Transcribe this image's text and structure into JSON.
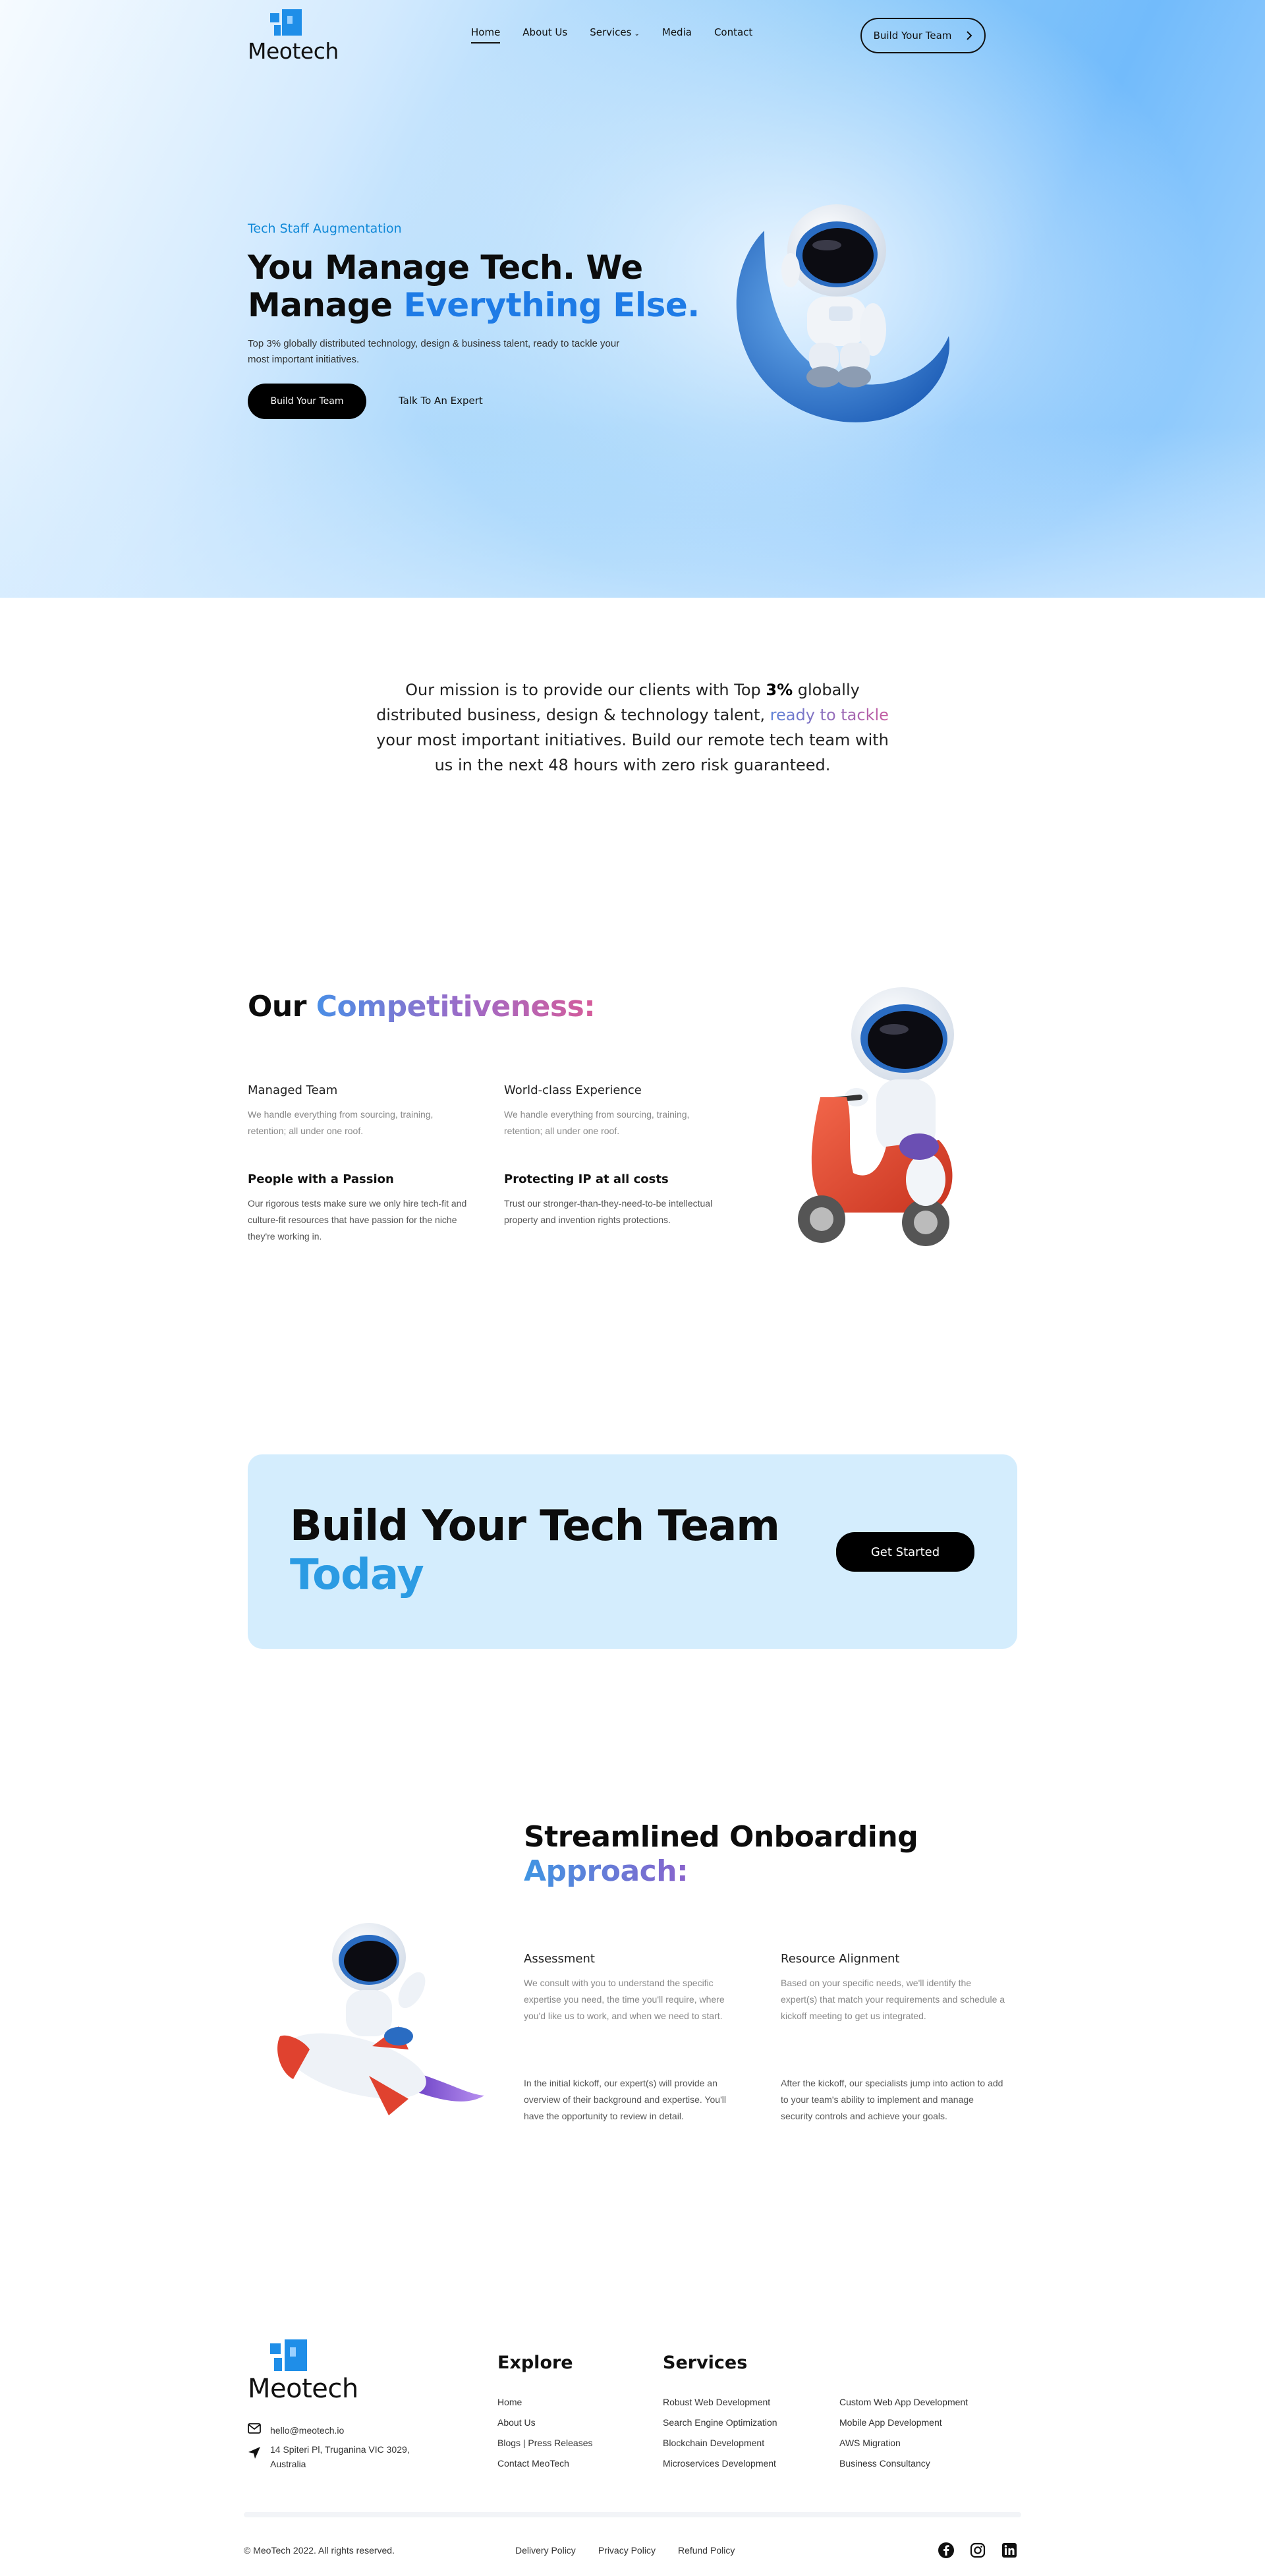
{
  "brand": {
    "name": "Meotech",
    "color": "#1f8ee8"
  },
  "nav": {
    "items": [
      {
        "label": "Home",
        "active": true
      },
      {
        "label": "About Us",
        "active": false
      },
      {
        "label": "Services",
        "active": false,
        "dropdown": true
      },
      {
        "label": "Media",
        "active": false
      },
      {
        "label": "Contact",
        "active": false
      }
    ],
    "cta_label": "Build Your Team",
    "cta_icon": "chevron-right-icon"
  },
  "hero": {
    "eyebrow": "Tech Staff Augmentation",
    "title_line1": "You Manage Tech. We",
    "title_line2_plain": "Manage ",
    "title_line2_accent": "Everything Else.",
    "description": "Top 3% globally distributed technology, design & business talent, ready to tackle your most important initiatives.",
    "primary_button": "Build Your Team",
    "secondary_button": "Talk To An Expert",
    "illustration": "astronaut-on-moon"
  },
  "mission": {
    "part1": "Our mission is to provide our clients with Top ",
    "bold": "3%",
    "part2": " globally distributed business, design & technology talent, ",
    "highlight": "ready to tackle",
    "part3": " your most important initiatives. Build our remote tech team with us in the next 48 hours with zero risk guaranteed."
  },
  "competitiveness": {
    "title_plain": "Our ",
    "title_accent": "Competitiveness:",
    "features": [
      {
        "title": "Managed Team",
        "text": "We handle everything from sourcing, training, retention; all under one roof."
      },
      {
        "title": "World-class Experience",
        "text": "We handle everything from sourcing, training, retention; all under one roof."
      },
      {
        "title": "People with a Passion",
        "text": "Our rigorous tests make sure we only hire tech-fit and culture-fit resources that have passion for the niche they're working in."
      },
      {
        "title": "Protecting IP at all costs",
        "text": "Trust our stronger-than-they-need-to-be intellectual property and invention rights protections."
      }
    ],
    "illustration": "astronaut-on-scooter"
  },
  "cta": {
    "title_line1": "Build Your Tech Team",
    "title_line2": "Today",
    "button": "Get Started"
  },
  "onboarding": {
    "title_line1": "Streamlined Onboarding",
    "title_line2": "Approach:",
    "illustration": "astronaut-on-rocket",
    "steps": [
      {
        "title": "Assessment",
        "text": "We consult with you to understand the specific expertise you need, the time you'll require, where you'd like us to work, and when we need to start."
      },
      {
        "title": "Resource Alignment",
        "text": "Based on your specific needs, we'll identify the expert(s) that match your requirements and schedule a kickoff meeting to get us integrated."
      },
      {
        "title": "",
        "text": "In the initial kickoff, our expert(s) will provide an overview of their background and expertise. You'll have the opportunity to review in detail."
      },
      {
        "title": "",
        "text": "After the kickoff, our specialists jump into action to add to your team's ability to implement and manage security controls and achieve your goals."
      }
    ]
  },
  "footer": {
    "email": "hello@meotech.io",
    "address_line1": "14 Spiteri Pl, Truganina VIC 3029,",
    "address_line2": "Australia",
    "explore_title": "Explore",
    "explore": [
      "Home",
      "About Us",
      "Blogs | Press Releases",
      "Contact MeoTech"
    ],
    "services_title": "Services",
    "services_col1": [
      "Robust Web Development",
      "Search Engine Optimization",
      "Blockchain Development",
      "Microservices Development"
    ],
    "services_col2": [
      "Custom Web App Development",
      "Mobile App Development",
      "AWS Migration",
      "Business Consultancy"
    ],
    "copyright": "© MeoTech 2022. All rights reserved.",
    "legal": [
      "Delivery Policy",
      "Privacy Policy",
      "Refund Policy"
    ],
    "socials": [
      "facebook-icon",
      "instagram-icon",
      "linkedin-icon"
    ]
  }
}
